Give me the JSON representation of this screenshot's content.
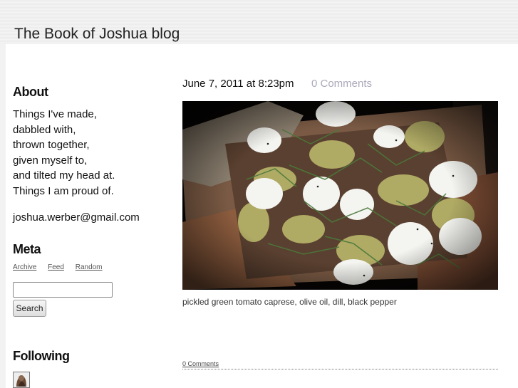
{
  "blog": {
    "title": "The Book of Joshua blog"
  },
  "sidebar": {
    "about": {
      "heading": "About",
      "lines": [
        "Things I've made,",
        "dabbled with,",
        "thrown together,",
        "given myself to,",
        "and tilted my head at.",
        "Things I am proud of."
      ],
      "email": "joshua.werber@gmail.com"
    },
    "meta": {
      "heading": "Meta",
      "links": [
        "Archive",
        "Feed",
        "Random"
      ]
    },
    "search": {
      "value": "",
      "button_label": "Search"
    },
    "following": {
      "heading": "Following"
    }
  },
  "post": {
    "date": "June 7, 2011 at 8:23pm",
    "comments_top": "0 Comments",
    "caption": "pickled green tomato caprese, olive oil, dill, black pepper",
    "comments_bottom": "0 Comments"
  }
}
